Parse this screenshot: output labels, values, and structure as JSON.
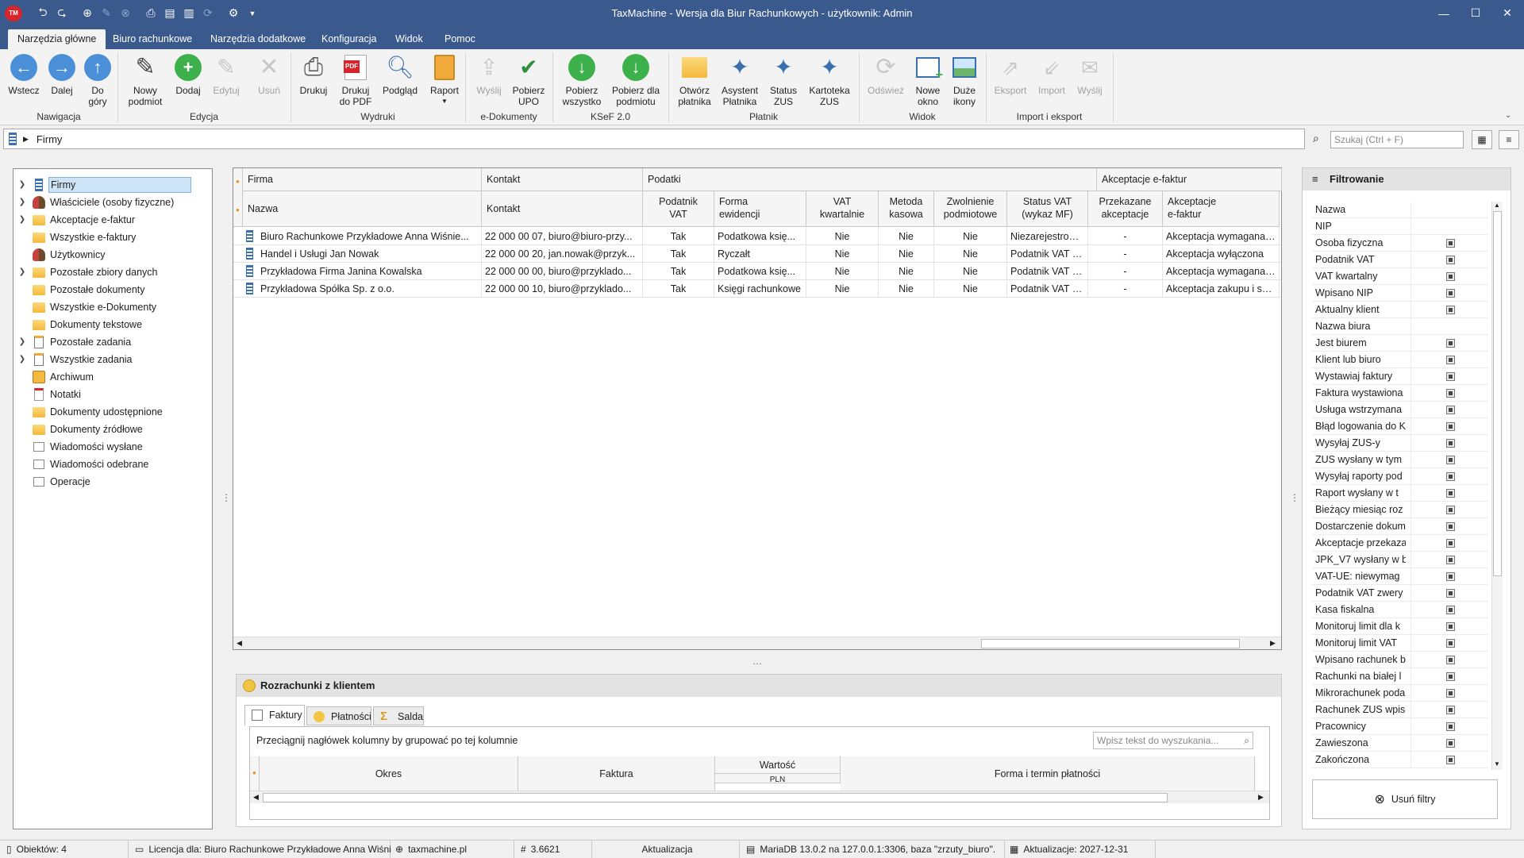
{
  "app": {
    "title": "TaxMachine  -  Wersja dla Biur Rachunkowych  -  użytkownik: Admin",
    "logo": "TM"
  },
  "ribbon_tabs": [
    "Narzędzia główne",
    "Biuro rachunkowe",
    "Narzędzia dodatkowe",
    "Konfiguracja",
    "Widok",
    "Pomoc"
  ],
  "ribbon": {
    "groups": {
      "nawigacja": "Nawigacja",
      "edycja": "Edycja",
      "wydruki": "Wydruki",
      "edokumenty": "e-Dokumenty",
      "ksef": "KSeF 2.0",
      "platnik": "Płatnik",
      "widok": "Widok",
      "import": "Import i eksport"
    },
    "buttons": {
      "wstecz": "Wstecz",
      "dalej": "Dalej",
      "do_gory_1": "Do",
      "do_gory_2": "góry",
      "nowy_1": "Nowy",
      "nowy_2": "podmiot",
      "dodaj": "Dodaj",
      "edytuj": "Edytuj",
      "usun": "Usuń",
      "drukuj": "Drukuj",
      "drukuj_pdf_1": "Drukuj",
      "drukuj_pdf_2": "do PDF",
      "podglad": "Podgląd",
      "raport": "Raport",
      "wyslij": "Wyślij",
      "pobierz_upo_1": "Pobierz",
      "pobierz_upo_2": "UPO",
      "pobierz_wszystko_1": "Pobierz",
      "pobierz_wszystko_2": "wszystko",
      "pobierz_podmiot_1": "Pobierz dla",
      "pobierz_podmiot_2": "podmiotu",
      "otworz_1": "Otwórz",
      "otworz_2": "płatnika",
      "asystent_1": "Asystent",
      "asystent_2": "Płatnika",
      "status_zus_1": "Status",
      "status_zus_2": "ZUS",
      "kartoteka_1": "Kartoteka",
      "kartoteka_2": "ZUS",
      "odswiez": "Odśwież",
      "nowe_okno_1": "Nowe",
      "nowe_okno_2": "okno",
      "duze_ikony_1": "Duże",
      "duze_ikony_2": "ikony",
      "eksport": "Eksport",
      "import": "Import",
      "wyslij2": "Wyślij"
    },
    "pdf_badge": "PDF"
  },
  "navbar": {
    "path": "Firmy",
    "search_placeholder": "Szukaj (Ctrl + F)"
  },
  "tree": [
    {
      "label": "Firmy",
      "expandable": true,
      "icon": "building-icon",
      "selected": true
    },
    {
      "label": "Właściciele (osoby fizyczne)",
      "expandable": true,
      "icon": "users-icon"
    },
    {
      "label": "Akceptacje e-faktur",
      "expandable": true,
      "icon": "folder-icon"
    },
    {
      "label": "Wszystkie e-faktury",
      "expandable": false,
      "icon": "folder-icon"
    },
    {
      "label": "Użytkownicy",
      "expandable": false,
      "icon": "users-icon"
    },
    {
      "label": "Pozostałe zbiory danych",
      "expandable": true,
      "icon": "folder-icon"
    },
    {
      "label": "Pozostałe dokumenty",
      "expandable": false,
      "icon": "folder-icon"
    },
    {
      "label": "Wszystkie e-Dokumenty",
      "expandable": false,
      "icon": "folder-icon"
    },
    {
      "label": "Dokumenty tekstowe",
      "expandable": false,
      "icon": "folder-icon"
    },
    {
      "label": "Pozostałe zadania",
      "expandable": true,
      "icon": "task-icon"
    },
    {
      "label": "Wszystkie zadania",
      "expandable": true,
      "icon": "task-icon"
    },
    {
      "label": "Archiwum",
      "expandable": false,
      "icon": "archive-icon"
    },
    {
      "label": "Notatki",
      "expandable": false,
      "icon": "note-icon"
    },
    {
      "label": "Dokumenty udostępnione",
      "expandable": false,
      "icon": "folder-icon"
    },
    {
      "label": "Dokumenty źródłowe",
      "expandable": false,
      "icon": "folder-icon"
    },
    {
      "label": "Wiadomości wysłane",
      "expandable": false,
      "icon": "mail-icon"
    },
    {
      "label": "Wiadomości odebrane",
      "expandable": false,
      "icon": "mail-icon"
    },
    {
      "label": "Operacje",
      "expandable": false,
      "icon": "operation-icon"
    }
  ],
  "grid": {
    "bands": [
      "Firma",
      "Kontakt",
      "Podatki",
      "Akceptacje e-faktur"
    ],
    "columns": [
      {
        "l1": "Nazwa",
        "l2": ""
      },
      {
        "l1": "Kontakt",
        "l2": ""
      },
      {
        "l1": "Podatnik",
        "l2": "VAT"
      },
      {
        "l1": "Forma",
        "l2": "ewidencji"
      },
      {
        "l1": "VAT",
        "l2": "kwartalnie"
      },
      {
        "l1": "Metoda",
        "l2": "kasowa"
      },
      {
        "l1": "Zwolnienie",
        "l2": "podmiotowe"
      },
      {
        "l1": "Status VAT",
        "l2": "(wykaz MF)"
      },
      {
        "l1": "Przekazane",
        "l2": "akceptacje"
      },
      {
        "l1": "Akceptacje",
        "l2": "e-faktur"
      }
    ],
    "rows": [
      [
        "Biuro Rachunkowe Przykładowe Anna Wiśnie...",
        "22 000 00 07, biuro@biuro-przy...",
        "Tak",
        "Podatkowa księ...",
        "Nie",
        "Nie",
        "Nie",
        "Niezarejestrowany",
        "-",
        "Akceptacja wymagana ..."
      ],
      [
        "Handel i Usługi Jan Nowak",
        "22 000 00 20, jan.nowak@przyk...",
        "Tak",
        "Ryczałt",
        "Nie",
        "Nie",
        "Nie",
        "Podatnik VAT cz...",
        "-",
        "Akceptacja wyłączona"
      ],
      [
        "Przykładowa Firma Janina Kowalska",
        "22 000 00 00, biuro@przyklado...",
        "Tak",
        "Podatkowa księ...",
        "Nie",
        "Nie",
        "Nie",
        "Podatnik VAT cz...",
        "-",
        "Akceptacja wymagana ..."
      ],
      [
        "Przykładowa Spółka Sp. z o.o.",
        "22 000 00 10, biuro@przyklado...",
        "Tak",
        "Księgi rachunkowe",
        "Nie",
        "Nie",
        "Nie",
        "Podatnik VAT cz...",
        "-",
        "Akceptacja zakupu i sp..."
      ]
    ]
  },
  "bottom": {
    "title": "Rozrachunki z klientem",
    "tabs": [
      "Faktury",
      "Płatności",
      "Salda"
    ],
    "group_hint": "Przeciągnij nagłówek kolumny by grupować po tej kolumnie",
    "search_placeholder": "Wpisz tekst do wyszukania...",
    "columns": [
      "Okres",
      "Faktura",
      "Wartość",
      "Forma i termin płatności"
    ],
    "sub_column": "PLN"
  },
  "filter": {
    "title": "Filtrowanie",
    "clear_label": "Usuń filtry",
    "rows": [
      {
        "label": "Nazwa",
        "checkbox": false
      },
      {
        "label": "NIP",
        "checkbox": false
      },
      {
        "label": "Osoba fizyczna",
        "checkbox": true
      },
      {
        "label": "Podatnik VAT",
        "checkbox": true
      },
      {
        "label": "VAT kwartalny",
        "checkbox": true
      },
      {
        "label": "Wpisano NIP",
        "checkbox": true
      },
      {
        "label": "Aktualny klient",
        "checkbox": true
      },
      {
        "label": "Nazwa biura",
        "checkbox": false
      },
      {
        "label": "Jest biurem",
        "checkbox": true
      },
      {
        "label": "Klient lub biuro",
        "checkbox": true
      },
      {
        "label": "Wystawiaj faktury",
        "checkbox": true
      },
      {
        "label": "Faktura wystawiona",
        "checkbox": true
      },
      {
        "label": "Usługa wstrzymana",
        "checkbox": true
      },
      {
        "label": "Błąd logowania do K",
        "checkbox": true
      },
      {
        "label": "Wysyłaj ZUS-y",
        "checkbox": true
      },
      {
        "label": "ZUS wysłany w tym",
        "checkbox": true
      },
      {
        "label": "Wysyłaj raporty pod",
        "checkbox": true
      },
      {
        "label": "Raport wysłany w t",
        "checkbox": true
      },
      {
        "label": "Bieżący miesiąc roz",
        "checkbox": true
      },
      {
        "label": "Dostarczenie dokum",
        "checkbox": true
      },
      {
        "label": "Akceptacje przekaza",
        "checkbox": true
      },
      {
        "label": "JPK_V7 wysłany w b",
        "checkbox": true
      },
      {
        "label": "VAT-UE: niewymag",
        "checkbox": true
      },
      {
        "label": "Podatnik VAT zwery",
        "checkbox": true
      },
      {
        "label": "Kasa fiskalna",
        "checkbox": true
      },
      {
        "label": "Monitoruj limit dla k",
        "checkbox": true
      },
      {
        "label": "Monitoruj limit VAT",
        "checkbox": true
      },
      {
        "label": "Wpisano rachunek b",
        "checkbox": true
      },
      {
        "label": "Rachunki na białej l",
        "checkbox": true
      },
      {
        "label": "Mikrorachunek poda",
        "checkbox": true
      },
      {
        "label": "Rachunek ZUS wpis",
        "checkbox": true
      },
      {
        "label": "Pracownicy",
        "checkbox": true
      },
      {
        "label": "Zawieszona",
        "checkbox": true
      },
      {
        "label": "Zakończona",
        "checkbox": true
      }
    ]
  },
  "statusbar": {
    "objects": "Obiektów: 4",
    "license": "Licencja dla: Biuro Rachunkowe Przykładowe Anna Wiśni",
    "website": "taxmachine.pl",
    "version": "3.6621",
    "update": "Aktualizacja",
    "db": "MariaDB 13.0.2 na 127.0.0.1:3306, baza \"zrzuty_biuro\".",
    "updates_until": "Aktualizacje: 2027-12-31"
  },
  "colors": {
    "titlebar": "#3a5a8e",
    "accent_blue": "#4a8fd8",
    "green": "#3cb04a",
    "folder": "#f4b93d"
  }
}
